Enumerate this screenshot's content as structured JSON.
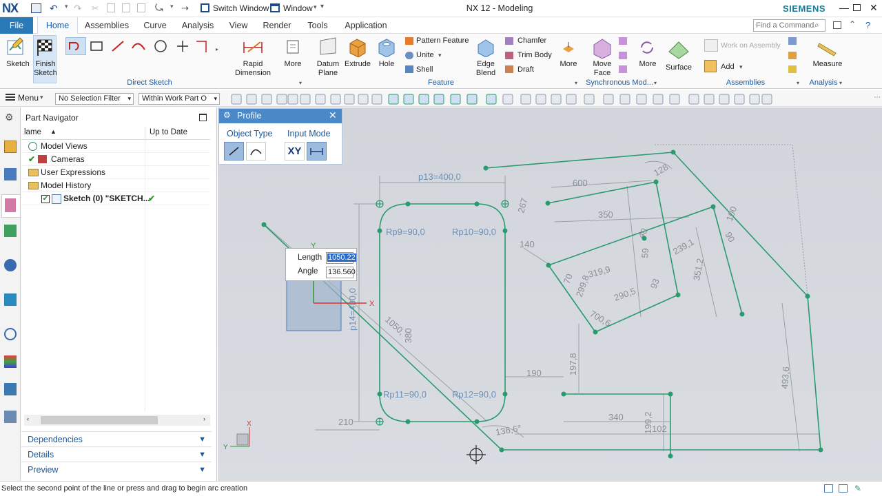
{
  "titlebar": {
    "logo": "NX",
    "title": "NX 12 - Modeling",
    "brand": "SIEMENS",
    "switch_window": "Switch Window",
    "window_menu": "Window"
  },
  "menu": {
    "file": "File",
    "tabs": [
      "Home",
      "Assemblies",
      "Curve",
      "Analysis",
      "View",
      "Render",
      "Tools",
      "Application"
    ],
    "search_placeholder": "Find a Command"
  },
  "ribbon": {
    "sketch": "Sketch",
    "finish_sketch_1": "Finish",
    "finish_sketch_2": "Sketch",
    "rapid_dim_1": "Rapid",
    "rapid_dim_2": "Dimension",
    "more": "More",
    "datum_1": "Datum",
    "datum_2": "Plane",
    "extrude": "Extrude",
    "hole": "Hole",
    "pattern_feature": "Pattern Feature",
    "unite": "Unite",
    "shell": "Shell",
    "edge_blend_1": "Edge",
    "edge_blend_2": "Blend",
    "chamfer": "Chamfer",
    "trim_body": "Trim Body",
    "draft": "Draft",
    "move_face_1": "Move",
    "move_face_2": "Face",
    "surface": "Surface",
    "work_on_assembly": "Work on Assembly",
    "add": "Add",
    "measure": "Measure",
    "groups": {
      "direct_sketch": "Direct Sketch",
      "feature": "Feature",
      "synchronous": "Synchronous Mod...",
      "assemblies": "Assemblies",
      "analysis": "Analysis"
    }
  },
  "toolbar2": {
    "menu": "Menu",
    "selection_filter": "No Selection Filter",
    "scope": "Within Work Part O"
  },
  "navigator": {
    "title": "Part Navigator",
    "col_name": "lame",
    "col_uptodate": "Up to Date",
    "items": [
      {
        "label": "Model Views",
        "level": 1
      },
      {
        "label": "Cameras",
        "level": 1
      },
      {
        "label": "User Expressions",
        "level": 1
      },
      {
        "label": "Model History",
        "level": 1
      },
      {
        "label": "Sketch (0) \"SKETCH...",
        "level": 2
      }
    ],
    "sections": [
      "Dependencies",
      "Details",
      "Preview"
    ]
  },
  "profile_dialog": {
    "title": "Profile",
    "object_type": "Object Type",
    "input_mode": "Input Mode",
    "xy": "XY"
  },
  "input_box": {
    "length_label": "Length",
    "length_value": "1050.22",
    "angle_label": "Angle",
    "angle_value": "136.560"
  },
  "dimensions": {
    "p13": "p13=400,0",
    "p14": "p14=400,0",
    "rp9": "Rp9=90,0",
    "rp10": "Rp10=90,0",
    "rp11": "Rp11=90,0",
    "rp12": "Rp12=90,0",
    "d600": "600",
    "d350": "350",
    "d140": "140",
    "d128": "128",
    "d267": "267",
    "d319": "319,9",
    "d299": "299,8",
    "d290": "290,5",
    "d700": "700,6",
    "d239": "239,1",
    "d351": "351,2",
    "d197": "197,8",
    "d190": "190",
    "d340": "340",
    "d102": "102",
    "d199": "199,2",
    "d493": "493,6",
    "d210": "210",
    "d1050": "1050,",
    "d380": "380",
    "d136": "136,6°",
    "d70": "70",
    "d90a": "90",
    "d100": "100",
    "d93": "93",
    "d59": "59",
    "d40": "40"
  },
  "status": {
    "message": "Select the second point of the line or press and drag to begin arc creation"
  },
  "colors": {
    "accent": "#1a5aa0",
    "sketch_green": "#2a9a6e",
    "dim_gray": "#8b8f96",
    "file_tab": "#2a7ab8"
  }
}
